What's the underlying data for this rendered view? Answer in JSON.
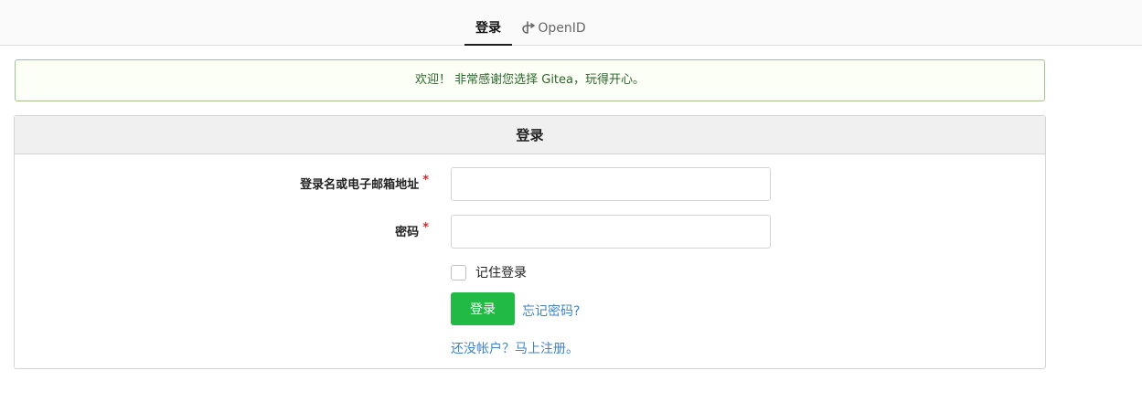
{
  "tabs": [
    {
      "label": "登录",
      "active": true
    },
    {
      "label": "OpenID",
      "icon": "openid-icon",
      "active": false
    }
  ],
  "welcome": {
    "message": "欢迎！ 非常感谢您选择 Gitea，玩得开心。"
  },
  "form": {
    "title": "登录",
    "username_label": "登录名或电子邮箱地址",
    "password_label": "密码",
    "required_marker": "*",
    "username_value": "",
    "password_value": "",
    "remember_label": "记住登录",
    "remember_checked": false,
    "signin_button": "登录",
    "forgot_link": "忘记密码?",
    "register_link": "还没帐户？马上注册。"
  },
  "colors": {
    "accent_green": "#21ba45",
    "link_blue": "#4183c4",
    "required_red": "#db2828",
    "welcome_text": "#2c662d",
    "welcome_bg": "#fcfff5"
  }
}
